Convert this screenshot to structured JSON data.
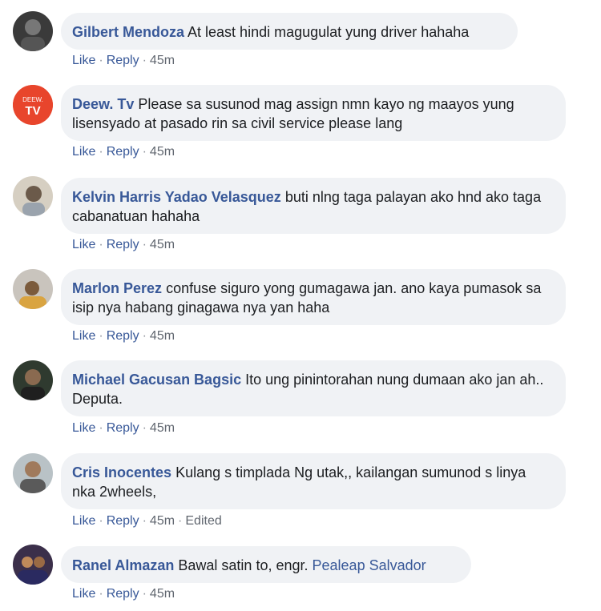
{
  "actions": {
    "like": "Like",
    "reply": "Reply",
    "separator": "·"
  },
  "comments": [
    {
      "author": "Gilbert Mendoza",
      "text": "At least hindi magugulat yung driver hahaha",
      "time": "45m"
    },
    {
      "author": "Deew. Tv",
      "avatar_text": "DEEW.",
      "avatar_text2": "TV",
      "text": "Please sa susunod mag assign nmn kayo ng maayos yung lisensyado at pasado rin sa civil service please lang",
      "time": "45m"
    },
    {
      "author": "Kelvin Harris Yadao Velasquez",
      "text": "buti nlng taga palayan ako hnd ako taga cabanatuan hahaha",
      "time": "45m"
    },
    {
      "author": "Marlon Perez",
      "text": "confuse siguro yong gumagawa jan. ano kaya pumasok sa isip nya habang ginagawa nya yan haha",
      "time": "45m"
    },
    {
      "author": "Michael Gacusan Bagsic",
      "text": "Ito ung pinintorahan nung dumaan ako jan ah.. Deputa.",
      "time": "45m"
    },
    {
      "author": "Cris Inocentes",
      "text": "Kulang s timplada Ng utak,, kailangan sumunod s linya nka 2wheels,",
      "time": "45m",
      "edited": "Edited"
    },
    {
      "author": "Ranel Almazan",
      "text": "Bawal satin to, engr.",
      "mention": "Pealeap Salvador",
      "time": "45m"
    }
  ],
  "colors": {
    "link": "#385898",
    "bubble": "#f0f2f5",
    "text": "#1c1e21",
    "meta": "#616770",
    "deew_red": "#e8452c"
  }
}
